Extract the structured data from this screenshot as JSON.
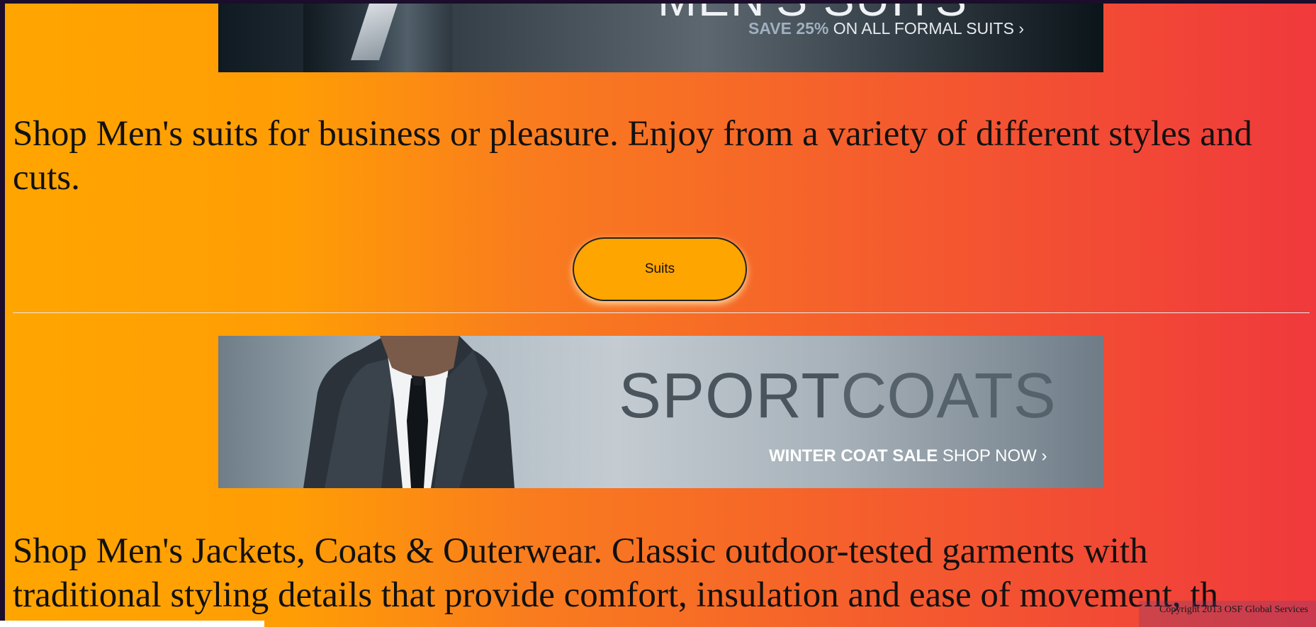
{
  "suits_banner": {
    "title": "MEN'S SUITS",
    "promo_highlight": "SAVE 25%",
    "promo_rest": "ON ALL FORMAL SUITS ›"
  },
  "suits_section": {
    "description": "Shop Men's suits for business or pleasure. Enjoy from a variety of different styles and cuts.",
    "button_label": "Suits"
  },
  "coats_banner": {
    "title_part1": "SPORT",
    "title_part2": "COATS",
    "promo_bold": "WINTER COAT SALE",
    "promo_rest": "SHOP NOW ›"
  },
  "coats_section": {
    "description": "Shop Men's Jackets, Coats & Outerwear. Classic outdoor-tested garments with traditional styling details that provide comfort, insulation and ease of movement, th"
  },
  "footer": {
    "copyright": "Copyright 2013 OSF Global Services"
  },
  "colors": {
    "gradient_start": "#ffa500",
    "gradient_end": "#f0393c",
    "button_bg": "#ffa500"
  }
}
